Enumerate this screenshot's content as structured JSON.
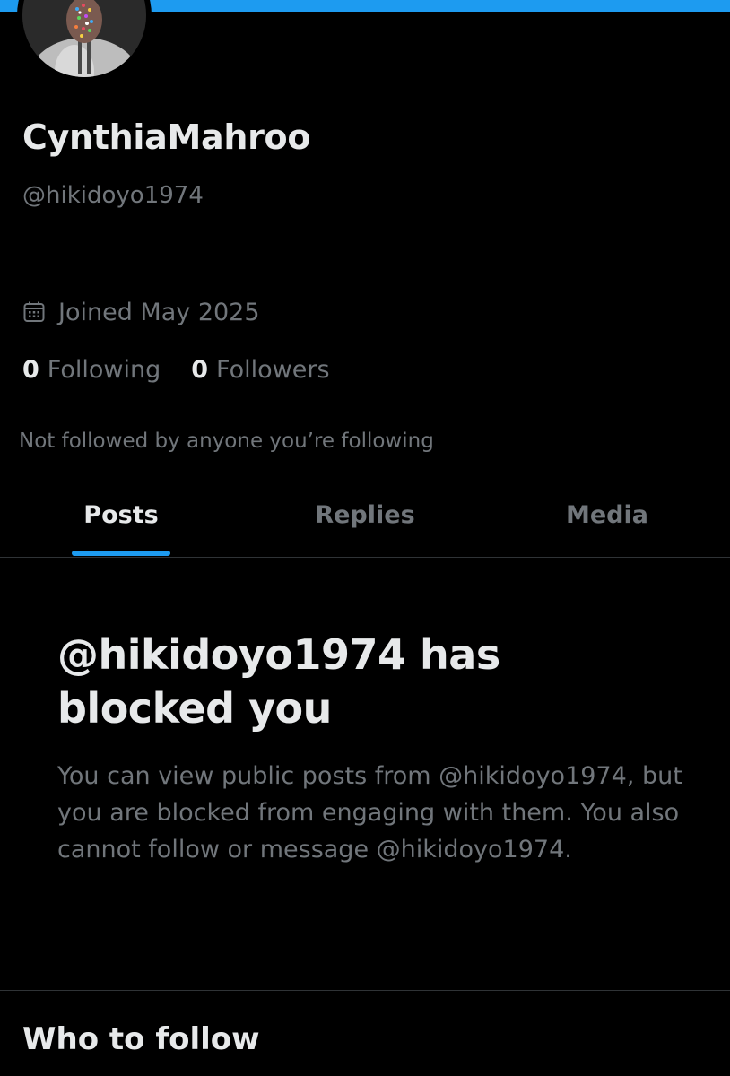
{
  "colors": {
    "background": "#000000",
    "accent": "#1d9bf0",
    "primary_text": "#e7e9ea",
    "secondary_text": "#71767b",
    "divider": "#2f3336"
  },
  "profile": {
    "avatar_icon": "profile-avatar",
    "display_name": "CynthiaMahroo",
    "handle": "@hikidoyo1974",
    "joined_icon": "calendar-icon",
    "joined": "Joined May 2025",
    "following_count": "0",
    "following_label": "Following",
    "followers_count": "0",
    "followers_label": "Followers",
    "not_followed": "Not followed by anyone you’re following"
  },
  "tabs": [
    {
      "label": "Posts",
      "active": true
    },
    {
      "label": "Replies",
      "active": false
    },
    {
      "label": "Media",
      "active": false
    }
  ],
  "blocked": {
    "title": "@hikidoyo1974 has blocked you",
    "body": "You can view public posts from @hikidoyo1974, but you are blocked from engaging with them. You also cannot follow or message @hikidoyo1974."
  },
  "sections": {
    "who_to_follow": "Who to follow"
  }
}
